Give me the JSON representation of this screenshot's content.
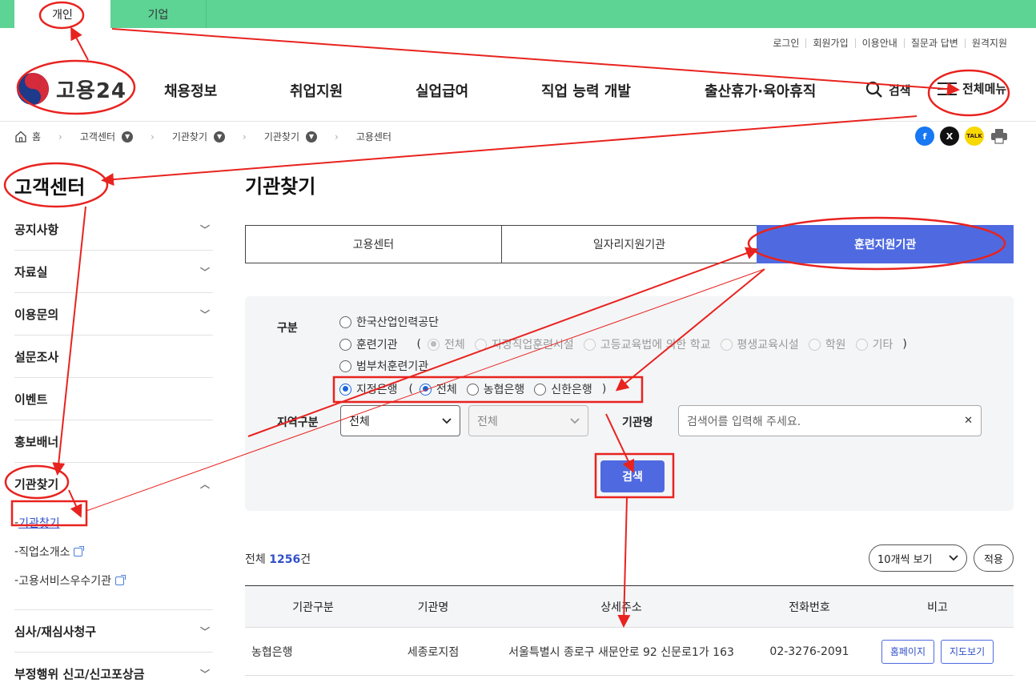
{
  "top_tabs": {
    "personal": "개인",
    "business": "기업"
  },
  "util_links": [
    "로그인",
    "회원가입",
    "이용안내",
    "질문과 답변",
    "원격지원"
  ],
  "logo": {
    "text": "고용24"
  },
  "gnb": {
    "items": [
      "채용정보",
      "취업지원",
      "실업급여",
      "직업 능력 개발",
      "출산휴가·육아휴직"
    ],
    "search": "검색",
    "menu": "전체메뉴"
  },
  "breadcrumb": {
    "home": "홈",
    "c1": "고객센터",
    "c2": "기관찾기",
    "c3": "기관찾기",
    "c4": "고용센터"
  },
  "share": {
    "facebook": "f",
    "x": "X",
    "kakao": "TALK"
  },
  "sidebar": {
    "title": "고객센터",
    "items": [
      "공지사항",
      "자료실",
      "이용문의",
      "설문조사",
      "이벤트",
      "홍보배너"
    ],
    "active": "기관찾기",
    "sub": [
      "기관찾기",
      "직업소개소",
      "고용서비스우수기관"
    ],
    "after": [
      "심사/재심사청구",
      "부정행위 신고/신고포상금"
    ]
  },
  "page_title": "기관찾기",
  "tabs": [
    "고용센터",
    "일자리지원기관",
    "훈련지원기관"
  ],
  "filter": {
    "category_label": "구분",
    "r1": "한국산업인력공단",
    "r2": "훈련기관",
    "r2_sub": [
      "전체",
      "지정직업훈련시설",
      "고등교육법에 의한 학교",
      "평생교육시설",
      "학원",
      "기타"
    ],
    "r3": "범부처훈련기관",
    "r4": "지정은행",
    "r4_sub": [
      "전체",
      "농협은행",
      "신한은행"
    ],
    "paren_open": "(",
    "paren_close": ")",
    "region_label": "지역구분",
    "region1": "전체",
    "region2": "전체",
    "name_label": "기관명",
    "search_placeholder": "검색어를 입력해 주세요.",
    "clear": "✕",
    "search_btn": "검색"
  },
  "result": {
    "prefix": "전체",
    "count": "1256",
    "suffix": "건",
    "per_page": "10개씩 보기",
    "apply": "적용"
  },
  "table": {
    "headers": [
      "기관구분",
      "기관명",
      "상세주소",
      "전화번호",
      "비고"
    ],
    "rows": [
      {
        "type": "농협은행",
        "name": "세종로지점",
        "address": "서울특별시 종로구 새문안로 92 신문로1가 163",
        "phone": "02-3276-2091",
        "btn1": "홈페이지",
        "btn2": "지도보기"
      }
    ]
  },
  "colors": {
    "green": "#5dd394",
    "accent": "#4f6ae0",
    "annotation": "#e8231f"
  }
}
